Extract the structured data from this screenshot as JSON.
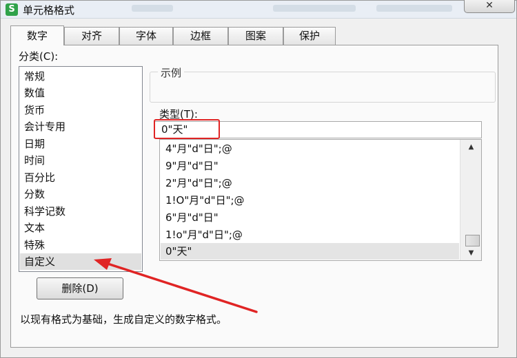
{
  "window": {
    "title": "单元格格式",
    "app_icon": "S",
    "close_symbol": "✕"
  },
  "tabs": [
    {
      "label": "数字",
      "active": true
    },
    {
      "label": "对齐"
    },
    {
      "label": "字体"
    },
    {
      "label": "边框"
    },
    {
      "label": "图案"
    },
    {
      "label": "保护"
    }
  ],
  "category": {
    "label": "分类(C):",
    "items": [
      "常规",
      "数值",
      "货币",
      "会计专用",
      "日期",
      "时间",
      "百分比",
      "分数",
      "科学记数",
      "文本",
      "特殊",
      "自定义"
    ],
    "selected": "自定义"
  },
  "example": {
    "label": "示例"
  },
  "type": {
    "label": "类型(T):",
    "value": "0\"天\"",
    "options": [
      "4\"月\"d\"日\";@",
      "9\"月\"d\"日\"",
      "2\"月\"d\"日\";@",
      "1!O\"月\"d\"日\";@",
      "6\"月\"d\"日\"",
      "1!o\"月\"d\"日\";@",
      "0\"天\""
    ],
    "selected": "0\"天\""
  },
  "buttons": {
    "delete": "删除(D)"
  },
  "description": "以现有格式为基础，生成自定义的数字格式。",
  "colors": {
    "annotation_red": "#e02424",
    "app_icon_green": "#2fa24a"
  },
  "icons": {
    "scroll_up": "▲",
    "scroll_down": "▼"
  }
}
